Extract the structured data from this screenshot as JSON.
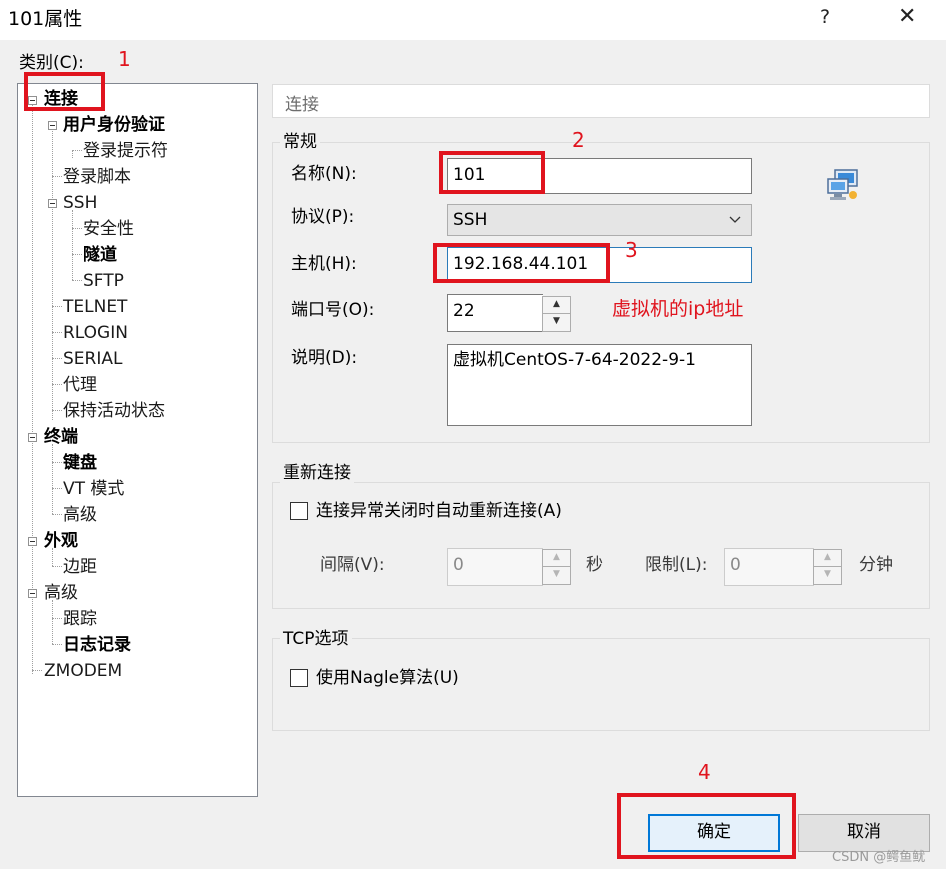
{
  "window": {
    "title": "101属性",
    "help_label": "?",
    "close_label": "✕"
  },
  "tree": {
    "label": "类别(C):",
    "items": [
      {
        "label": "连接"
      },
      {
        "label": "用户身份验证"
      },
      {
        "label": "登录提示符"
      },
      {
        "label": "登录脚本"
      },
      {
        "label": "SSH"
      },
      {
        "label": "安全性"
      },
      {
        "label": "隧道"
      },
      {
        "label": "SFTP"
      },
      {
        "label": "TELNET"
      },
      {
        "label": "RLOGIN"
      },
      {
        "label": "SERIAL"
      },
      {
        "label": "代理"
      },
      {
        "label": "保持活动状态"
      },
      {
        "label": "终端"
      },
      {
        "label": "键盘"
      },
      {
        "label": "VT 模式"
      },
      {
        "label": "高级"
      },
      {
        "label": "外观"
      },
      {
        "label": "边距"
      },
      {
        "label": "高级"
      },
      {
        "label": "跟踪"
      },
      {
        "label": "日志记录"
      },
      {
        "label": "ZMODEM"
      }
    ]
  },
  "panel": {
    "header": "连接",
    "general": {
      "title": "常规",
      "name_label": "名称(N):",
      "name_value": "101",
      "protocol_label": "协议(P):",
      "protocol_value": "SSH",
      "host_label": "主机(H):",
      "host_value": "192.168.44.101",
      "port_label": "端口号(O):",
      "port_value": "22",
      "desc_label": "说明(D):",
      "desc_value": "虚拟机CentOS-7-64-2022-9-1"
    },
    "reconnect": {
      "title": "重新连接",
      "checkbox_label": "连接异常关闭时自动重新连接(A)",
      "interval_label": "间隔(V):",
      "interval_value": "0",
      "interval_unit": "秒",
      "limit_label": "限制(L):",
      "limit_value": "0",
      "limit_unit": "分钟"
    },
    "tcp": {
      "title": "TCP选项",
      "checkbox_label": "使用Nagle算法(U)"
    }
  },
  "buttons": {
    "ok": "确定",
    "cancel": "取消"
  },
  "annotations": {
    "n1": "1",
    "n2": "2",
    "n3": "3",
    "n4": "4",
    "ip_note": "虚拟机的ip地址"
  },
  "watermark": "CSDN @鳄鱼鱿",
  "colors": {
    "annotation_red": "#e0141e",
    "default_button_border": "#0078d7"
  }
}
